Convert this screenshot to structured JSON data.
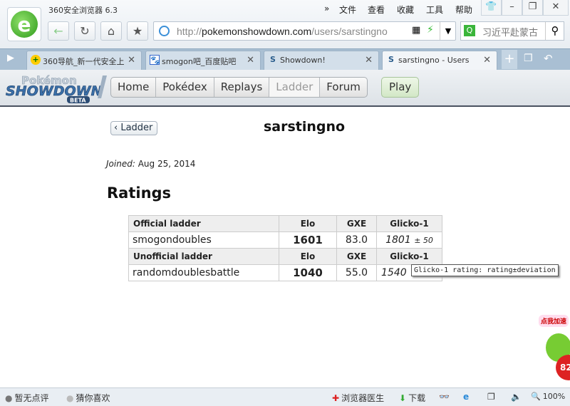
{
  "browser": {
    "title": "360安全浏览器 6.3",
    "menu": [
      "»",
      "文件",
      "查看",
      "收藏",
      "工具",
      "帮助"
    ],
    "url_prefix": "http://",
    "url_domain": "pokemonshowdown.com",
    "url_path": "/users/sarstingno",
    "search_placeholder": "习近平赴蒙古"
  },
  "tabs": [
    {
      "label": "360导航_新一代安全上网导航",
      "icon": "360-icon"
    },
    {
      "label": "smogon吧_百度贴吧",
      "icon": "baidu-paw-icon"
    },
    {
      "label": "Showdown!",
      "icon": "showdown-icon"
    },
    {
      "label": "sarstingno - Users",
      "icon": "showdown-icon",
      "active": true
    }
  ],
  "site": {
    "logo_text": "Pokémon Showdown BETA",
    "nav": [
      "Home",
      "Pokédex",
      "Replays",
      "Ladder",
      "Forum"
    ],
    "current": "Ladder",
    "play": "Play"
  },
  "profile": {
    "back": "Ladder",
    "username": "sarstingno",
    "joined_label": "Joined:",
    "joined_date": "Aug 25, 2014",
    "ratings_title": "Ratings"
  },
  "table": {
    "official": {
      "header": [
        "Official ladder",
        "Elo",
        "GXE",
        "Glicko-1"
      ],
      "rows": [
        {
          "ladder": "smogondoubles",
          "elo": "1601",
          "gxe": "83.0",
          "glicko": "1801",
          "dev": "± 50"
        }
      ]
    },
    "unofficial": {
      "header": [
        "Unofficial ladder",
        "Elo",
        "GXE",
        "Glicko-1"
      ],
      "rows": [
        {
          "ladder": "randomdoublesbattle",
          "elo": "1040",
          "gxe": "55.0",
          "glicko": "1540",
          "dev": ""
        }
      ]
    }
  },
  "tooltip": "Glicko-1 rating: rating±deviation",
  "status": {
    "left": [
      "暂无点评",
      "猜你喜欢"
    ],
    "doctor": "浏览器医生",
    "download": "下载",
    "zoom": "100%",
    "speed_label": "点我加速",
    "speed_value": "82"
  },
  "colors": {
    "accent": "#2e9a1a",
    "tab_strip": "#a9bfd3",
    "header_border": "#4a5260"
  }
}
